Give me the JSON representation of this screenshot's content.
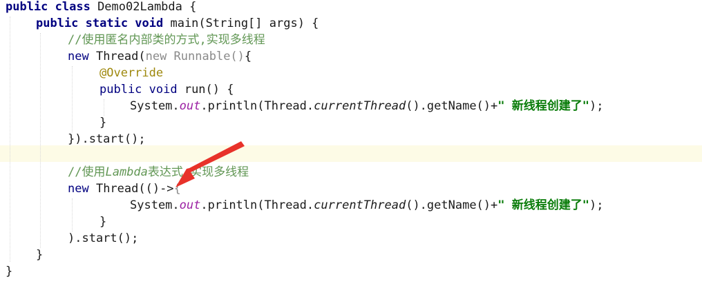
{
  "code": {
    "l1_kw": "public class ",
    "l1_rest": "Demo02Lambda {",
    "l2_kw": "public static void ",
    "l2_rest": "main(String[] args) {",
    "l3_comment": "//使用匿名内部类的方式,实现多线程",
    "l4_kw": "new ",
    "l4_cls": "Thread(",
    "l4_gray": "new Runnable()",
    "l4_end": "{",
    "l5_ann": "@Override",
    "l6_kw": "public void ",
    "l6_rest": "run() {",
    "l7_a": "System.",
    "l7_out": "out",
    "l7_b": ".println(Thread.",
    "l7_ct": "currentThread",
    "l7_c": "().getName()+",
    "l7_str": "\" 新线程创建了\"",
    "l7_end": ");",
    "l8": "}",
    "l9": "}).start();",
    "l11_c1": "//使用",
    "l11_c2": "Lambda",
    "l11_c3": "表达式,实现多线程",
    "l12_kw": "new ",
    "l12_rest": "Thread(()->",
    "l12_brace": "{",
    "l13_a": "System.",
    "l13_out": "out",
    "l13_b": ".println(Thread.",
    "l13_ct": "currentThread",
    "l13_c": "().getName()+",
    "l13_str": "\" 新线程创建了\"",
    "l13_end": ");",
    "l14": "}",
    "l15": ").start();",
    "l16": "}",
    "l17": "}"
  },
  "colors": {
    "keyword": "#000080",
    "comment": "#629755",
    "string": "#0a7c0a",
    "annotation": "#9e880d",
    "static_field": "#9b1fa3",
    "arrow": "#e8322a"
  }
}
